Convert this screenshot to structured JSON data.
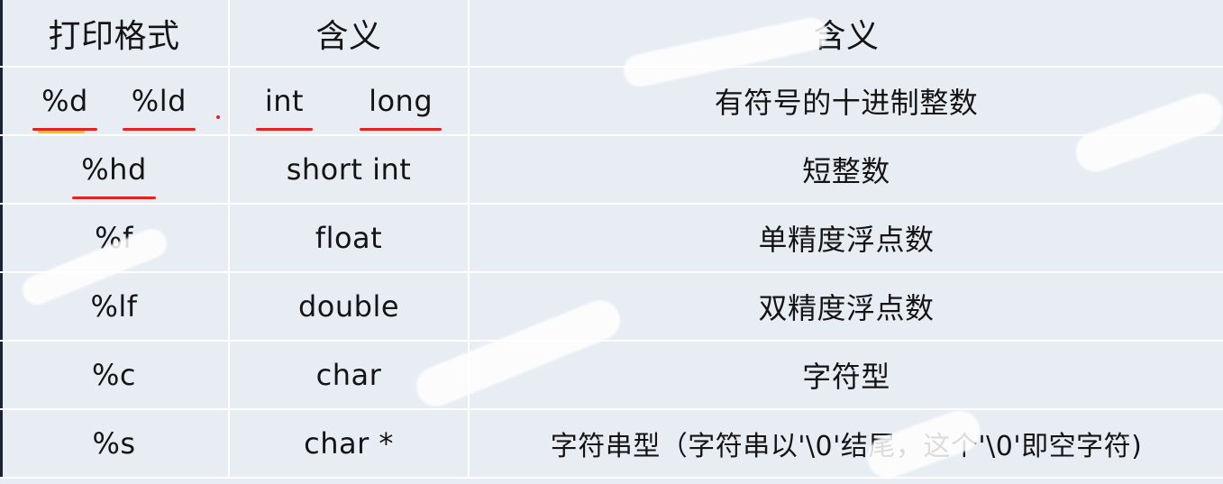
{
  "headers": [
    "打印格式",
    "含义",
    "含义"
  ],
  "rows": [
    {
      "formats": [
        "%d",
        "%ld"
      ],
      "types": [
        "int",
        "long"
      ],
      "meaning": "有符号的十进制整数"
    },
    {
      "formats": [
        "%hd"
      ],
      "types": [
        "short int"
      ],
      "meaning": "短整数"
    },
    {
      "formats": [
        "%f"
      ],
      "types": [
        "float"
      ],
      "meaning": "单精度浮点数"
    },
    {
      "formats": [
        "%lf"
      ],
      "types": [
        "double"
      ],
      "meaning": "双精度浮点数"
    },
    {
      "formats": [
        "%c"
      ],
      "types": [
        "char"
      ],
      "meaning": "字符型"
    },
    {
      "formats": [
        "%s"
      ],
      "types": [
        "char *"
      ],
      "meaning": "字符串型（字符串以'\\0'结尾，这个'\\0'即空字符)"
    }
  ],
  "colors": {
    "cell_bg": "#e8edf4",
    "grid": "#ffffff",
    "annotation": "#e32222",
    "highlight": "#f2c417"
  }
}
